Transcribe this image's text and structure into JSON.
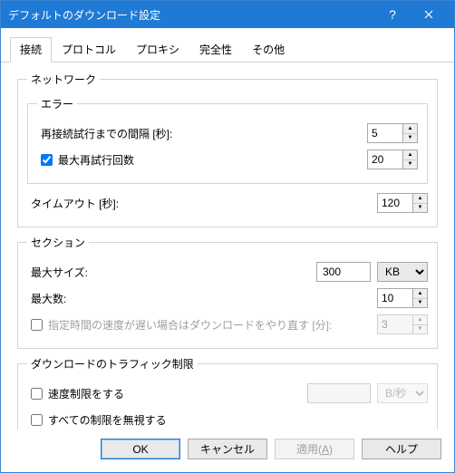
{
  "title": "デフォルトのダウンロード設定",
  "tabs": [
    "接続",
    "プロトコル",
    "プロキシ",
    "完全性",
    "その他"
  ],
  "network": {
    "legend": "ネットワーク",
    "error": {
      "legend": "エラー",
      "retry_interval_label": "再接続試行までの間隔 [秒]:",
      "retry_interval_value": "5",
      "max_retry_label": "最大再試行回数",
      "max_retry_value": "20"
    },
    "timeout_label": "タイムアウト [秒]:",
    "timeout_value": "120"
  },
  "section": {
    "legend": "セクション",
    "max_size_label": "最大サイズ:",
    "max_size_value": "300",
    "max_size_unit": "KB",
    "max_count_label": "最大数:",
    "max_count_value": "10",
    "slow_retry_label": "指定時間の速度が遅い場合はダウンロードをやり直す [分]:",
    "slow_retry_value": "3"
  },
  "traffic": {
    "legend": "ダウンロードのトラフィック制限",
    "limit_label": "速度制限をする",
    "limit_value": "",
    "limit_unit": "B/秒",
    "ignore_label": "すべての制限を無視する"
  },
  "buttons": {
    "ok": "OK",
    "cancel": "キャンセル",
    "apply": "適用(",
    "apply_accel": "A",
    "apply_suffix": ")",
    "help": "ヘルプ"
  }
}
